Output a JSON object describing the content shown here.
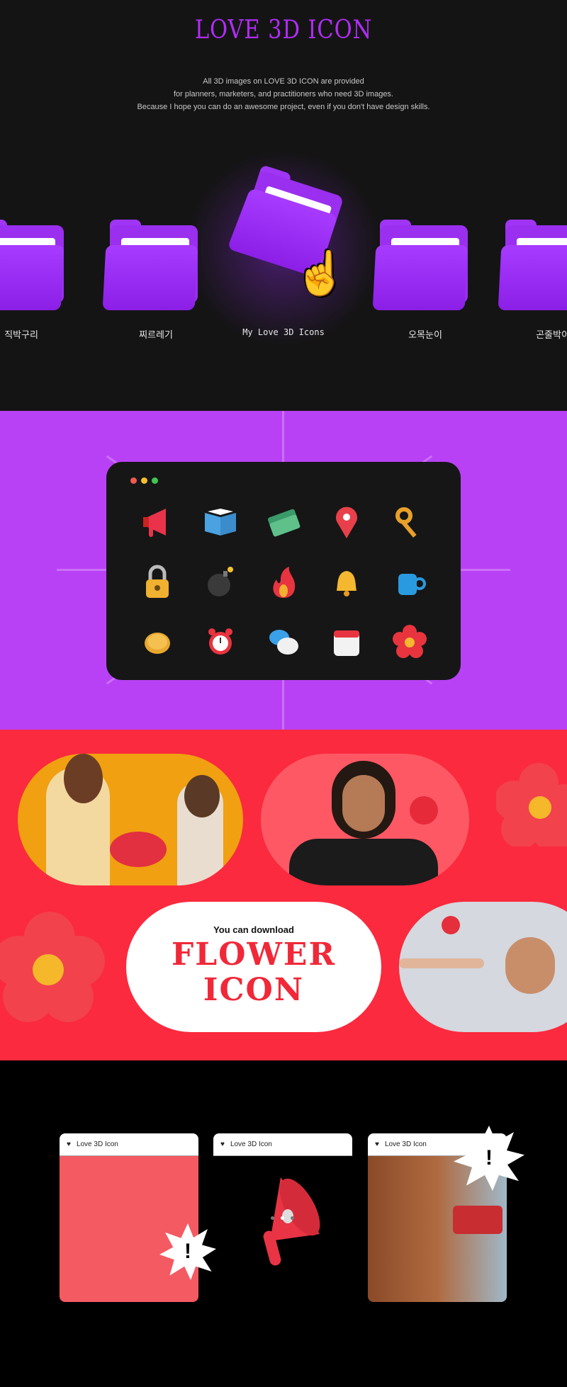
{
  "hero": {
    "title": "LOVE 3D ICON",
    "description": [
      "All 3D images on LOVE 3D ICON are provided",
      "for planners, marketers, and practitioners who need 3D images.",
      "Because I hope you can do an awesome project, even if you don't have design skills."
    ],
    "folders": [
      {
        "label": "직박구리"
      },
      {
        "label": "찌르레기"
      },
      {
        "label": "My Love 3D Icons",
        "active": true
      },
      {
        "label": "오목눈이"
      },
      {
        "label": "곤줄박이"
      }
    ],
    "accent": "#b02cf5"
  },
  "showcase": {
    "window_dots": [
      "#f05a4f",
      "#f6bd2e",
      "#3fc650"
    ],
    "icons": [
      "megaphone-icon",
      "book-icon",
      "money-icon",
      "location-pin-icon",
      "key-icon",
      "padlock-icon",
      "bomb-icon",
      "fire-icon",
      "bell-icon",
      "mug-icon",
      "coin-icon",
      "alarm-clock-icon",
      "chat-bubbles-icon",
      "calendar-icon",
      "flower-icon"
    ],
    "background": "#b941f5"
  },
  "flower": {
    "subtitle": "You can download",
    "title_line1": "FLOWER",
    "title_line2": "ICON",
    "background": "#fb2a3e"
  },
  "cards": {
    "items": [
      {
        "label": "Love 3D Icon"
      },
      {
        "label": "Love 3D Icon"
      },
      {
        "label": "Love 3D Icon"
      }
    ],
    "pager_active": 1,
    "pager_count": 3
  }
}
